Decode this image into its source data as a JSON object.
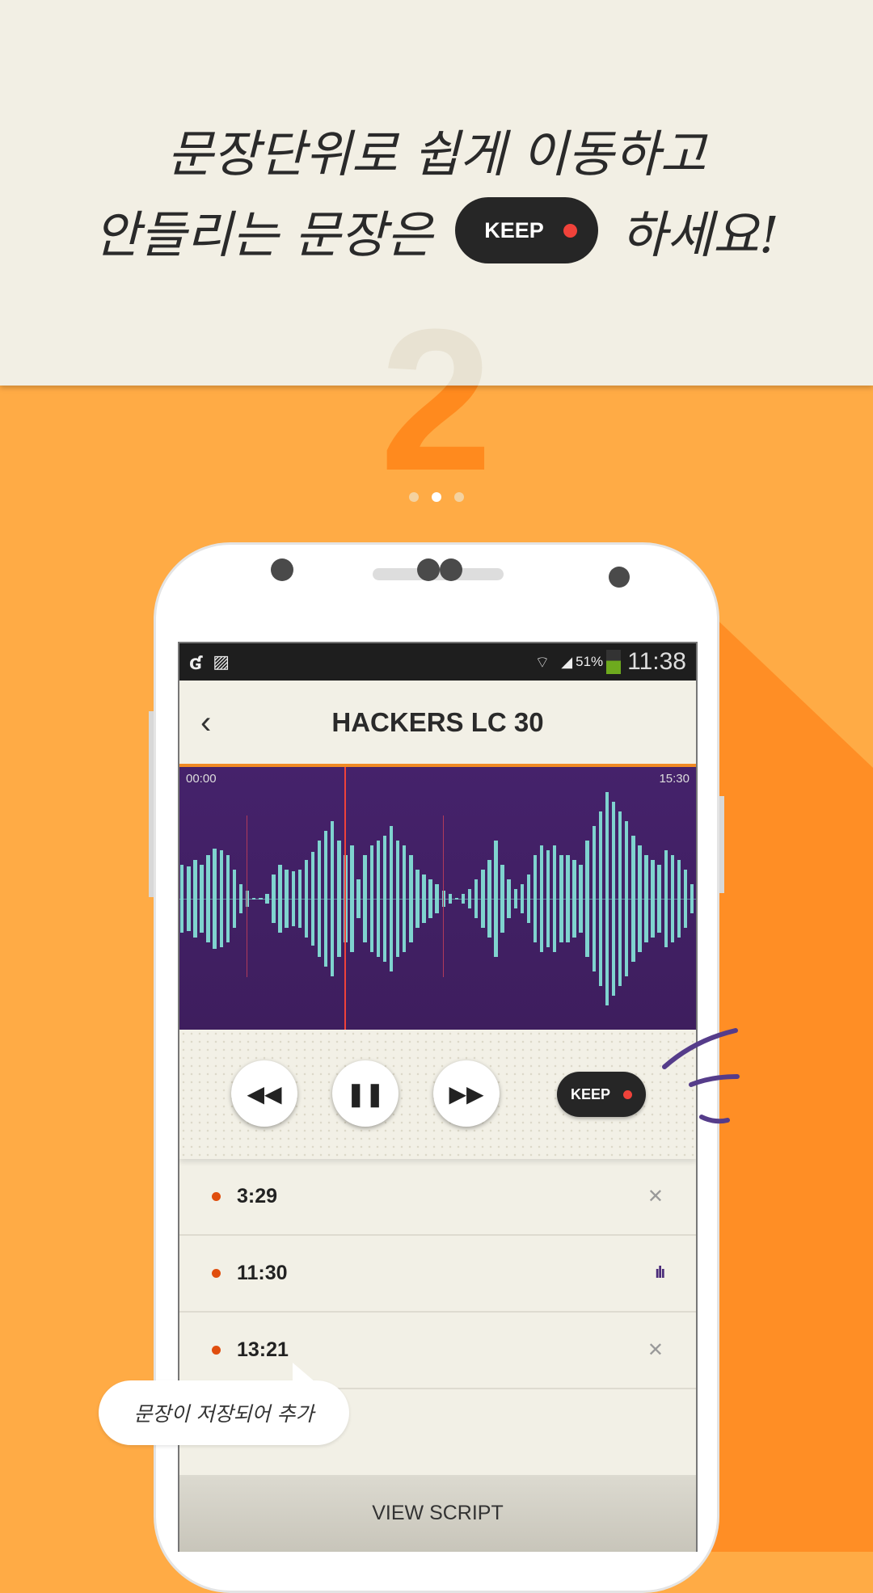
{
  "promo": {
    "line1": "문장단위로 쉽게 이동하고",
    "line2_before": "안들리는 문장은",
    "keep_label": "KEEP",
    "line2_after": "하세요!",
    "step_number": "2",
    "pager": {
      "count": 3,
      "active_index": 1
    },
    "bubble_text": "문장이 저장되어 추가"
  },
  "status_bar": {
    "battery": "51%",
    "time": "11:38",
    "battery_level": 0.51
  },
  "app": {
    "title": "HACKERS LC 30",
    "waveform": {
      "start_time": "00:00",
      "end_time": "15:30",
      "playhead_fraction": 0.32,
      "markers": [
        0.13,
        0.51
      ],
      "amplitudes": [
        35,
        33,
        40,
        35,
        45,
        52,
        50,
        45,
        30,
        15,
        8,
        0,
        0,
        5,
        25,
        35,
        30,
        28,
        30,
        40,
        48,
        60,
        70,
        80,
        60,
        45,
        55,
        20,
        45,
        55,
        60,
        65,
        75,
        60,
        55,
        45,
        30,
        25,
        20,
        15,
        8,
        5,
        0,
        5,
        10,
        20,
        30,
        40,
        60,
        35,
        20,
        10,
        15,
        25,
        45,
        55,
        50,
        55,
        45,
        45,
        40,
        35,
        60,
        75,
        90,
        110,
        100,
        90,
        80,
        65,
        55,
        45,
        40,
        35,
        50,
        45,
        40,
        30,
        15
      ]
    },
    "controls": {
      "rewind": "rewind",
      "pause": "pause",
      "forward": "fast-forward",
      "keep_label": "KEEP"
    },
    "bookmarks": [
      {
        "time": "3:29",
        "action": "remove"
      },
      {
        "time": "11:30",
        "action": "playing"
      },
      {
        "time": "13:21",
        "action": "remove"
      }
    ],
    "view_script_label": "VIEW SCRIPT"
  },
  "colors": {
    "accent": "#F08A24",
    "wave_bg": "#45226B",
    "wave_bar": "#7FD3CF",
    "playhead": "#F0423A"
  }
}
